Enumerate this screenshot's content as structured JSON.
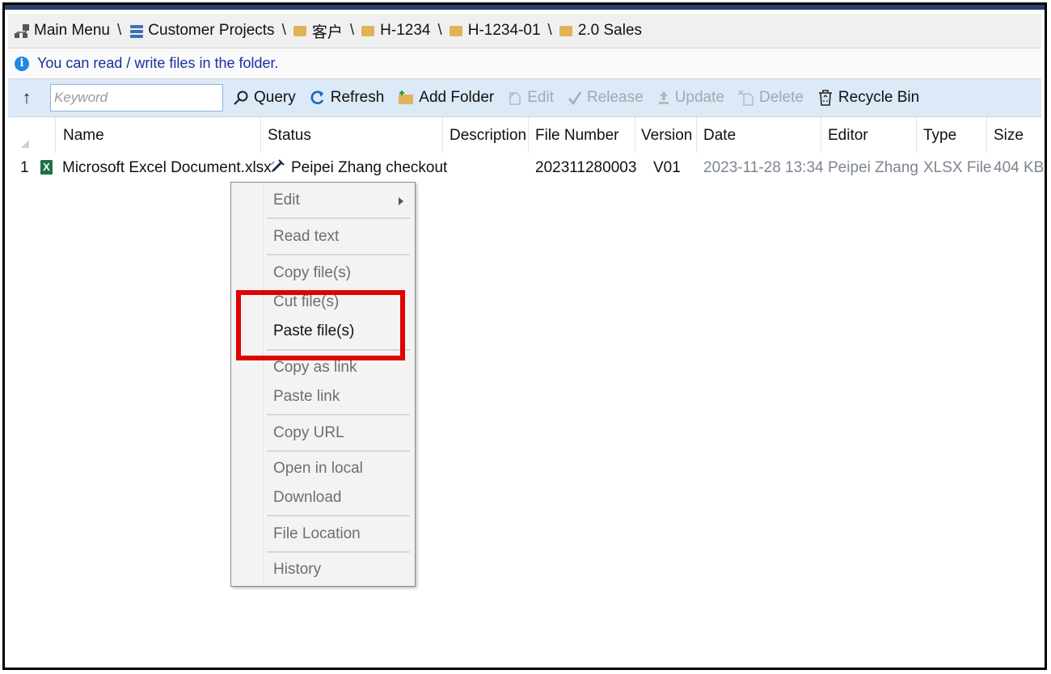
{
  "breadcrumb": {
    "items": [
      {
        "label": "Main Menu",
        "icon": "tree-icon"
      },
      {
        "label": "Customer Projects",
        "icon": "database-icon"
      },
      {
        "label": "客户",
        "icon": "folder-icon"
      },
      {
        "label": "H-1234",
        "icon": "folder-icon"
      },
      {
        "label": "H-1234-01",
        "icon": "folder-icon"
      },
      {
        "label": "2.0 Sales",
        "icon": "folder-icon"
      }
    ],
    "separator": "\\"
  },
  "info": {
    "message": "You can read / write files in the folder.",
    "icon": "info-icon"
  },
  "toolbar": {
    "search_placeholder": "Keyword",
    "query": "Query",
    "refresh": "Refresh",
    "add_folder": "Add Folder",
    "edit": "Edit",
    "release": "Release",
    "update": "Update",
    "delete": "Delete",
    "recycle_bin": "Recycle Bin"
  },
  "table": {
    "columns": {
      "name": "Name",
      "status": "Status",
      "description": "Description",
      "file_number": "File Number",
      "version": "Version",
      "date": "Date",
      "editor": "Editor",
      "type": "Type",
      "size": "Size"
    },
    "rows": [
      {
        "index": "1",
        "name": "Microsoft Excel Document.xlsx",
        "status": "Peipei Zhang checkout",
        "description": "",
        "file_number": "202311280003",
        "version": "V01",
        "date": "2023-11-28 13:34",
        "editor": "Peipei Zhang",
        "type": "XLSX File",
        "size": "404 KB"
      }
    ]
  },
  "context_menu": {
    "items": [
      {
        "label": "Edit",
        "has_submenu": true
      },
      {
        "label": "Read text"
      },
      {
        "label": "Copy file(s)"
      },
      {
        "label": "Cut file(s)"
      },
      {
        "label": "Paste file(s)",
        "enabled": true
      },
      {
        "label": "Copy as link"
      },
      {
        "label": "Paste link"
      },
      {
        "label": "Copy URL"
      },
      {
        "label": "Open in local"
      },
      {
        "label": "Download"
      },
      {
        "label": "File Location"
      },
      {
        "label": "History"
      }
    ]
  },
  "colors": {
    "toolbar_bg": "#dce9f7",
    "info_text": "#1a2fa0",
    "highlight": "#e00000",
    "excel_green": "#1f7244"
  }
}
